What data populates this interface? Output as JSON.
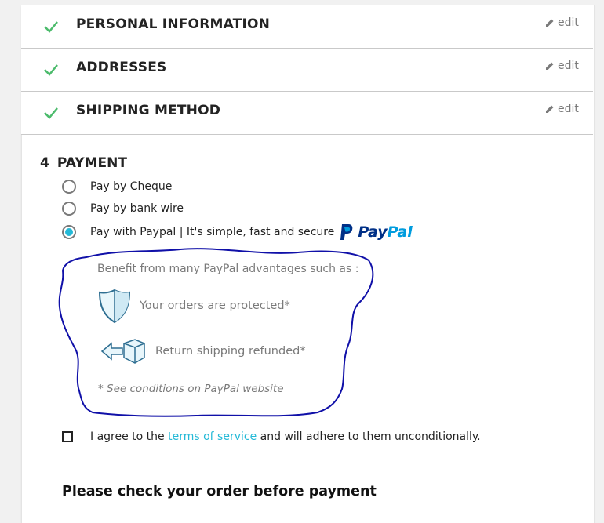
{
  "steps": [
    {
      "title": "PERSONAL INFORMATION",
      "edit": "edit"
    },
    {
      "title": "ADDRESSES",
      "edit": "edit"
    },
    {
      "title": "SHIPPING METHOD",
      "edit": "edit"
    }
  ],
  "payment": {
    "number": "4",
    "title": "PAYMENT",
    "options": [
      {
        "label": "Pay by Cheque",
        "selected": false
      },
      {
        "label": "Pay by bank wire",
        "selected": false
      },
      {
        "label": "Pay with Paypal | It's simple, fast and secure",
        "selected": true
      }
    ],
    "paypal_logo": {
      "pay": "Pay",
      "pal": "Pal"
    },
    "benefits_title": "Benefit from many PayPal advantages such as :",
    "benefits": [
      {
        "icon": "shield-icon",
        "label": "Your orders are protected*"
      },
      {
        "icon": "return-box-icon",
        "label": "Return shipping refunded*"
      }
    ],
    "conditions": "* See conditions on PayPal website"
  },
  "terms": {
    "prefix": "I agree to the",
    "link": "terms of service",
    "suffix": "and will adhere to them unconditionally."
  },
  "check_order_title": "Please check your order before payment",
  "colors": {
    "accent": "#24b9d7",
    "check": "#4cbb6c",
    "scribble": "#1010a8",
    "paypal_dark": "#003087",
    "paypal_light": "#009cde"
  }
}
